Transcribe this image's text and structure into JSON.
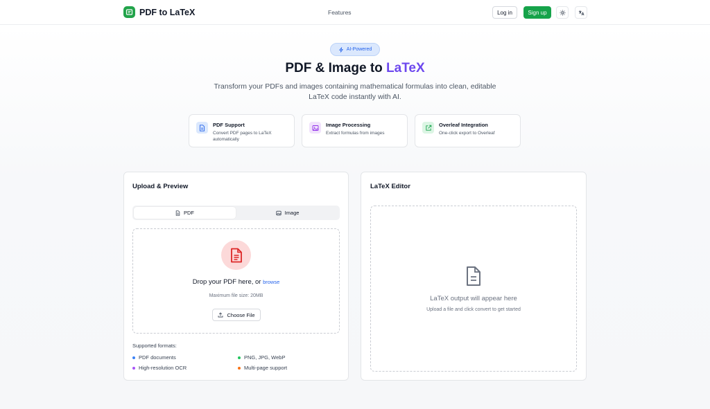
{
  "nav": {
    "brand": "PDF to LaTeX",
    "links": [
      "Features"
    ],
    "login_label": "Log in",
    "signup_label": "Sign up",
    "brand_color": "#22a34a",
    "theme_icon": "sun-icon",
    "language_icon": "translate-icon"
  },
  "hero": {
    "badge": "AI-Powered",
    "title_plain": "PDF & Image to ",
    "title_accent": "LaTeX",
    "accent_color": "#6d48ee",
    "subtitle": "Transform your PDFs and images containing mathematical formulas into clean, editable LaTeX code instantly with AI."
  },
  "features": [
    {
      "title": "PDF Support",
      "description": "Convert PDF pages to LaTeX automatically",
      "icon": "document-icon",
      "color": "#2563eb",
      "bg": "#dbe8fd"
    },
    {
      "title": "Image Processing",
      "description": "Extract formulas from images",
      "icon": "image-icon",
      "color": "#9333ea",
      "bg": "#f1e2fc"
    },
    {
      "title": "Overleaf Integration",
      "description": "One-click export to Overleaf",
      "icon": "external-link-icon",
      "color": "#16a34a",
      "bg": "#dcf5e4"
    }
  ],
  "upload": {
    "title": "Upload & Preview",
    "tabs": [
      {
        "label": "PDF",
        "active": true
      },
      {
        "label": "Image",
        "active": false
      }
    ],
    "drop_text": "Drop your PDF here, or",
    "browse_label": "browse",
    "max_size": "Maximum file size: 20MB",
    "choose_label": "Choose File",
    "formats_label": "Supported formats:",
    "formats": [
      {
        "label": "PDF documents",
        "color": "#3b82f6"
      },
      {
        "label": "PNG, JPG, WebP",
        "color": "#22c55e"
      },
      {
        "label": "High-resolution OCR",
        "color": "#a855f7"
      },
      {
        "label": "Multi-page support",
        "color": "#f97316"
      }
    ]
  },
  "editor": {
    "title": "LaTeX Editor",
    "empty_title": "LaTeX output will appear here",
    "empty_sub": "Upload a file and click convert to get started"
  }
}
